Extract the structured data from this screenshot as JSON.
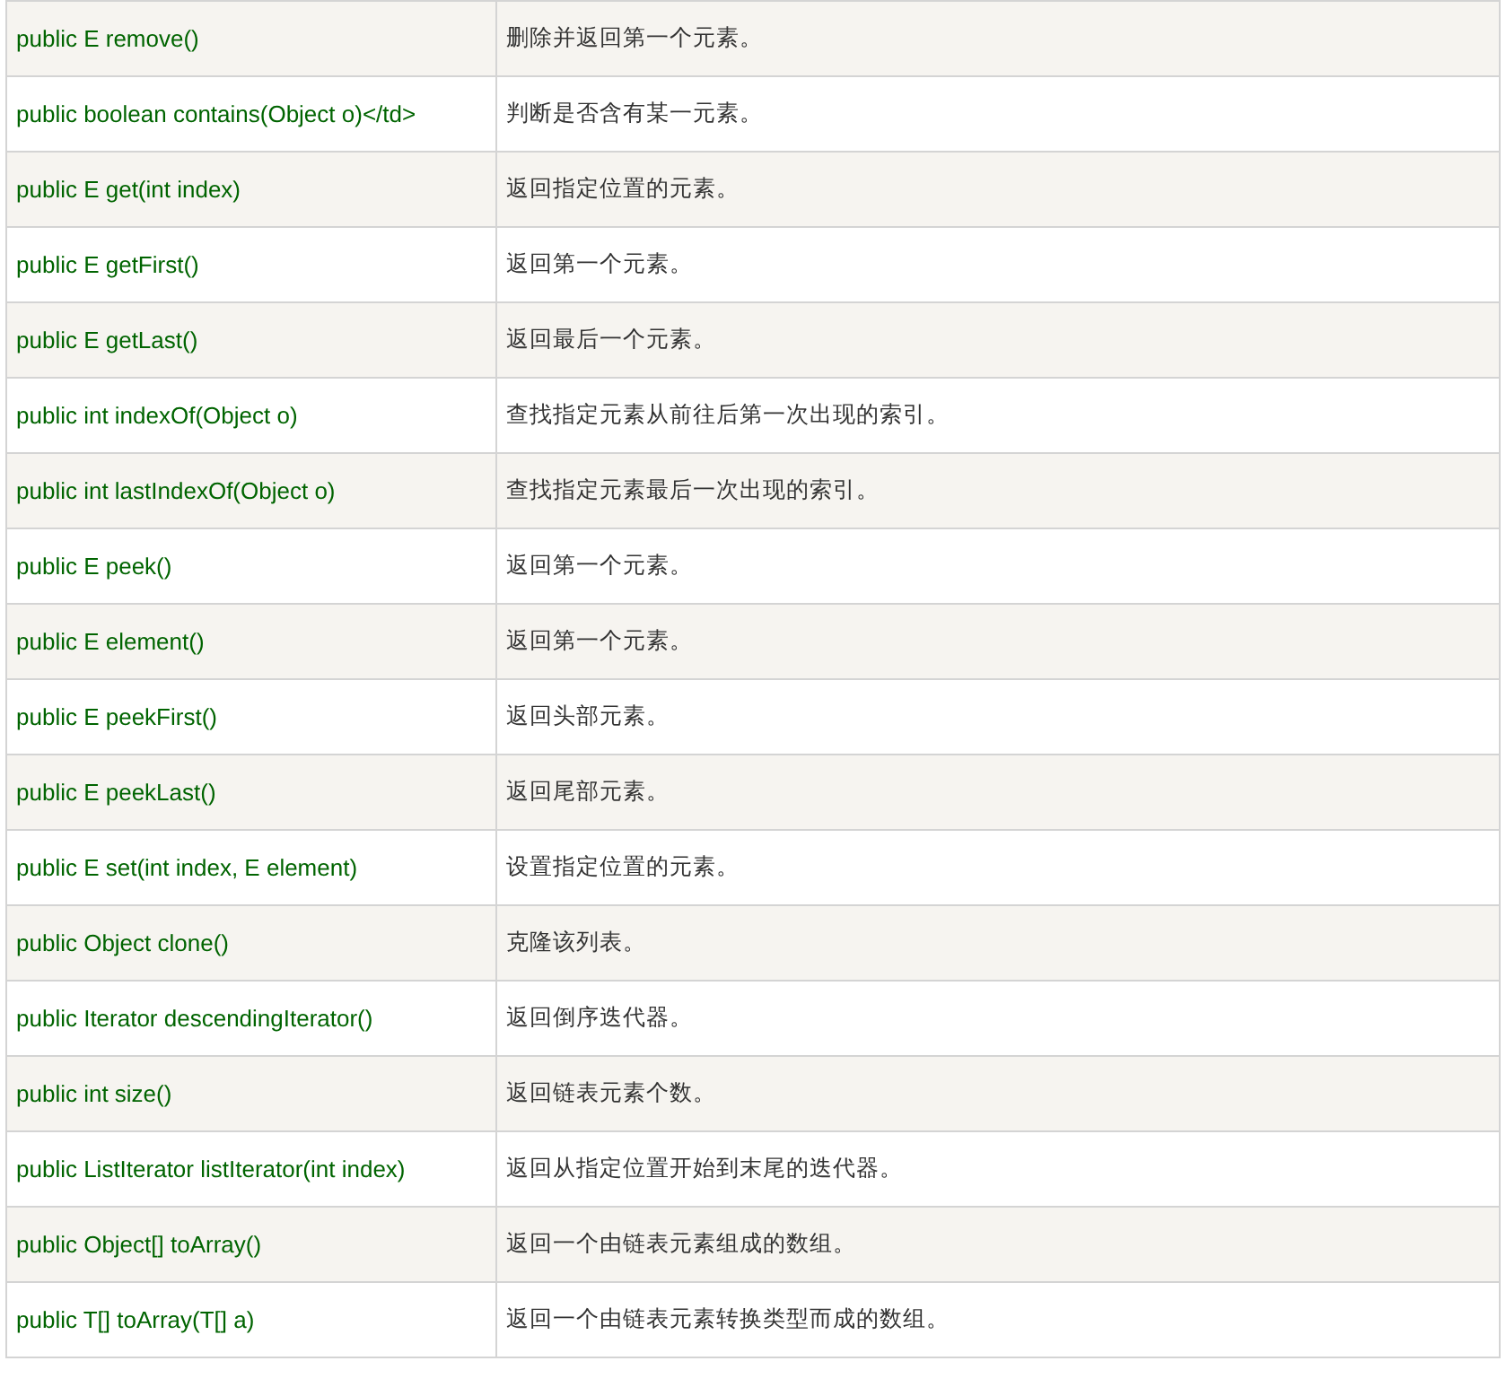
{
  "table": {
    "rows": [
      {
        "method": "public E remove()",
        "description": "删除并返回第一个元素。"
      },
      {
        "method": "public boolean contains(Object o)</td>",
        "description": "判断是否含有某一元素。"
      },
      {
        "method": "public E get(int index)",
        "description": "返回指定位置的元素。"
      },
      {
        "method": "public E getFirst()",
        "description": "返回第一个元素。"
      },
      {
        "method": "public E getLast()",
        "description": "返回最后一个元素。"
      },
      {
        "method": "public int indexOf(Object o)",
        "description": "查找指定元素从前往后第一次出现的索引。"
      },
      {
        "method": "public int lastIndexOf(Object o)",
        "description": "查找指定元素最后一次出现的索引。"
      },
      {
        "method": "public E peek()",
        "description": "返回第一个元素。"
      },
      {
        "method": "public E element()",
        "description": "返回第一个元素。"
      },
      {
        "method": "public E peekFirst()",
        "description": "返回头部元素。"
      },
      {
        "method": "public E peekLast()",
        "description": "返回尾部元素。"
      },
      {
        "method": "public E set(int index, E element)",
        "description": "设置指定位置的元素。"
      },
      {
        "method": "public Object clone()",
        "description": "克隆该列表。"
      },
      {
        "method": "public Iterator descendingIterator()",
        "description": "返回倒序迭代器。"
      },
      {
        "method": "public int size()",
        "description": "返回链表元素个数。"
      },
      {
        "method": "public ListIterator listIterator(int index)",
        "description": "返回从指定位置开始到末尾的迭代器。"
      },
      {
        "method": "public Object[] toArray()",
        "description": "返回一个由链表元素组成的数组。"
      },
      {
        "method": "public T[] toArray(T[] a)",
        "description": "返回一个由链表元素转换类型而成的数组。"
      }
    ]
  }
}
